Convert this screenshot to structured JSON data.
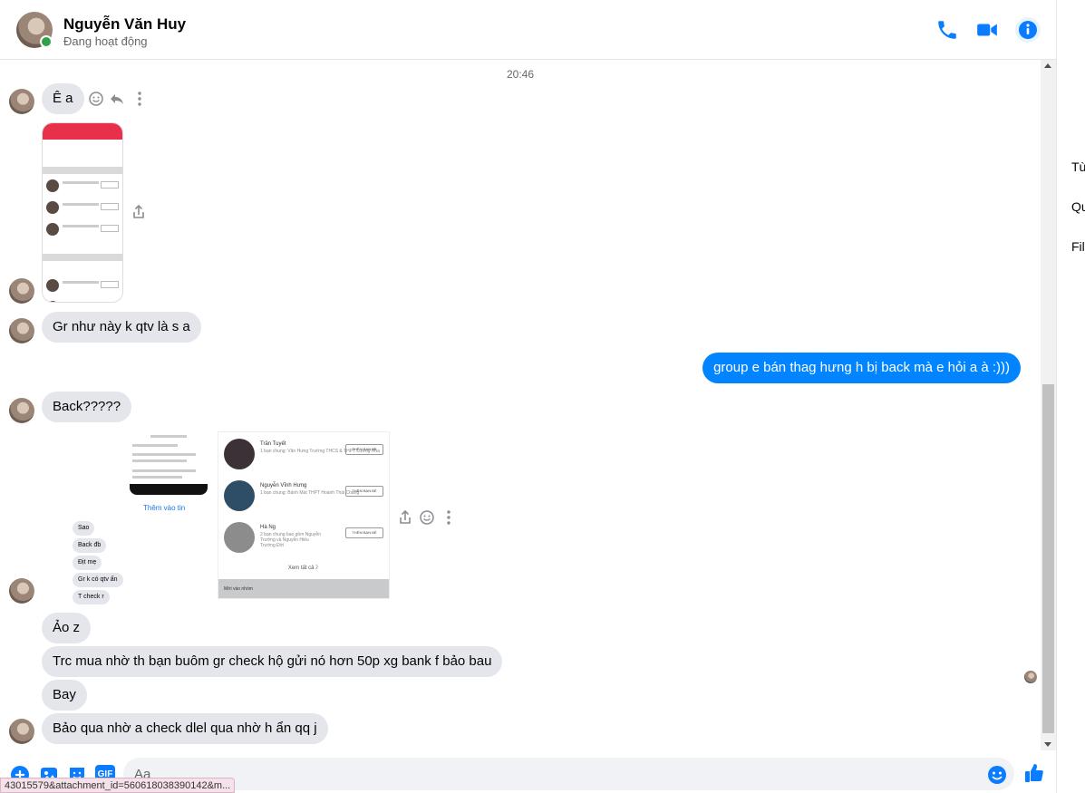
{
  "header": {
    "name": "Nguyễn Văn Huy",
    "status": "Đang hoạt động",
    "icons": [
      "phone-icon",
      "video-camera-icon",
      "info-icon"
    ]
  },
  "right_panel": {
    "items": [
      "Tù",
      "Qu",
      "Fil"
    ]
  },
  "chat": {
    "timestamp": "20:46",
    "messages": {
      "m1": "Ê a",
      "m2": "Gr như này k qtv là s a",
      "m3": "group e bán thag hưng h bị back mà e hỏi a à :)))",
      "m4": "Back?????",
      "m5": "Ảo z",
      "m6": "Trc mua nhờ th bạn buôm gr check hộ gửi nó hơn 50p xg bank f bảo bau",
      "m7": "Bay",
      "m8": "Bảo qua nhờ a check dlel qua nhờ h ẩn qq j"
    },
    "attachment_screenshot": {
      "add_story": "Thêm vào tin",
      "list": [
        "Sao",
        "Back đb",
        "Địt mẹ",
        "Gr k có qtv ấn",
        "T check r"
      ],
      "rows": [
        {
          "name": "Trần Tuyết",
          "sub": "1 bạn chung: Văn Hưng\nTrường THCS & THPT Lương Hòa",
          "btn": "THÊM BẠN BÈ"
        },
        {
          "name": "Nguyễn Vĩnh Hưng",
          "sub": "1 bạn chung: Bảnh Mát\nTHPT Hoành Thái Chang",
          "btn": "THÊM BẠN BÈ"
        },
        {
          "name": "Hà Ng",
          "sub": "2 bạn chung bao gồm Nguyễn\nTrường và Nguyễn Hiếu\nTrường Đời",
          "btn": "THÊM BẠN BÈ"
        }
      ],
      "see_all": "Xem tất cả  〉",
      "footer": "Mời vào nhóm"
    }
  },
  "composer": {
    "placeholder": "Aa",
    "icons": [
      "plus-icon",
      "photo-icon",
      "sticker-icon",
      "gif-icon",
      "emoji-icon",
      "like-icon"
    ],
    "gif_label": "GIF"
  },
  "statusbar": {
    "url": "43015579&attachment_id=560618038390142&m..."
  },
  "colors": {
    "accent": "#0084ff",
    "icon_blue": "#0a7cff",
    "online": "#31a24c",
    "incoming_bubble": "#e4e6eb"
  }
}
